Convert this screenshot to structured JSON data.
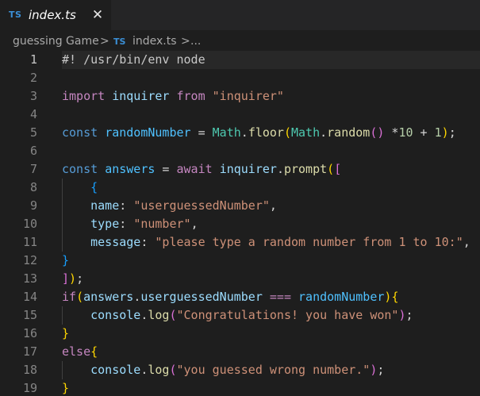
{
  "tab": {
    "icon_text": "TS",
    "filename": "index.ts",
    "close_glyph": "✕"
  },
  "breadcrumb": {
    "folder": "guessing Game",
    "sep1": ">",
    "ts_icon": "TS",
    "file": "index.ts",
    "sep2": ">",
    "more": "..."
  },
  "colors": {
    "background": "#1e1e1e",
    "keyword": "#c586c0",
    "storage": "#569cd6",
    "variable": "#9cdcfe",
    "constant": "#4fc1ff",
    "function": "#dcdcaa",
    "string": "#ce9178",
    "number": "#b5cea8",
    "ts_icon": "#3b8fd6"
  },
  "editor": {
    "current_line": 1,
    "lines": [
      {
        "n": "1",
        "tokens": [
          {
            "c": "cmt",
            "t": "#! /usr/bin/env node"
          }
        ]
      },
      {
        "n": "2",
        "tokens": []
      },
      {
        "n": "3",
        "tokens": [
          {
            "c": "kw",
            "t": "import"
          },
          {
            "c": "txt",
            "t": " "
          },
          {
            "c": "var",
            "t": "inquirer"
          },
          {
            "c": "txt",
            "t": " "
          },
          {
            "c": "kw",
            "t": "from"
          },
          {
            "c": "txt",
            "t": " "
          },
          {
            "c": "str",
            "t": "\"inquirer\""
          }
        ]
      },
      {
        "n": "4",
        "tokens": []
      },
      {
        "n": "5",
        "tokens": [
          {
            "c": "kw2",
            "t": "const"
          },
          {
            "c": "txt",
            "t": " "
          },
          {
            "c": "cst",
            "t": "randomNumber"
          },
          {
            "c": "txt",
            "t": " = "
          },
          {
            "c": "obj",
            "t": "Math"
          },
          {
            "c": "txt",
            "t": "."
          },
          {
            "c": "fn",
            "t": "floor"
          },
          {
            "c": "br1",
            "t": "("
          },
          {
            "c": "obj",
            "t": "Math"
          },
          {
            "c": "txt",
            "t": "."
          },
          {
            "c": "fn",
            "t": "random"
          },
          {
            "c": "br2",
            "t": "()"
          },
          {
            "c": "txt",
            "t": " *"
          },
          {
            "c": "num",
            "t": "10"
          },
          {
            "c": "txt",
            "t": " + "
          },
          {
            "c": "num",
            "t": "1"
          },
          {
            "c": "br1",
            "t": ")"
          },
          {
            "c": "txt",
            "t": ";"
          }
        ]
      },
      {
        "n": "6",
        "tokens": []
      },
      {
        "n": "7",
        "tokens": [
          {
            "c": "kw2",
            "t": "const"
          },
          {
            "c": "txt",
            "t": " "
          },
          {
            "c": "cst",
            "t": "answers"
          },
          {
            "c": "txt",
            "t": " = "
          },
          {
            "c": "kw",
            "t": "await"
          },
          {
            "c": "txt",
            "t": " "
          },
          {
            "c": "var",
            "t": "inquirer"
          },
          {
            "c": "txt",
            "t": "."
          },
          {
            "c": "fn",
            "t": "prompt"
          },
          {
            "c": "br1",
            "t": "("
          },
          {
            "c": "br2",
            "t": "["
          }
        ]
      },
      {
        "n": "8",
        "tokens": [
          {
            "c": "txt",
            "t": "    "
          },
          {
            "c": "br3",
            "t": "{"
          }
        ],
        "guides": [
          1
        ]
      },
      {
        "n": "9",
        "tokens": [
          {
            "c": "txt",
            "t": "    "
          },
          {
            "c": "var",
            "t": "name"
          },
          {
            "c": "txt",
            "t": ": "
          },
          {
            "c": "str",
            "t": "\"userguessedNumber\""
          },
          {
            "c": "txt",
            "t": ","
          }
        ],
        "guides": [
          1
        ]
      },
      {
        "n": "10",
        "tokens": [
          {
            "c": "txt",
            "t": "    "
          },
          {
            "c": "var",
            "t": "type"
          },
          {
            "c": "txt",
            "t": ": "
          },
          {
            "c": "str",
            "t": "\"number\""
          },
          {
            "c": "txt",
            "t": ","
          }
        ],
        "guides": [
          1
        ]
      },
      {
        "n": "11",
        "tokens": [
          {
            "c": "txt",
            "t": "    "
          },
          {
            "c": "var",
            "t": "message"
          },
          {
            "c": "txt",
            "t": ": "
          },
          {
            "c": "str",
            "t": "\"please type a random number from 1 to 10:\""
          },
          {
            "c": "txt",
            "t": ","
          }
        ],
        "guides": [
          1
        ]
      },
      {
        "n": "12",
        "tokens": [
          {
            "c": "br3",
            "t": "}"
          }
        ]
      },
      {
        "n": "13",
        "tokens": [
          {
            "c": "br2",
            "t": "]"
          },
          {
            "c": "br1",
            "t": ")"
          },
          {
            "c": "txt",
            "t": ";"
          }
        ]
      },
      {
        "n": "14",
        "tokens": [
          {
            "c": "kw",
            "t": "if"
          },
          {
            "c": "br1",
            "t": "("
          },
          {
            "c": "var",
            "t": "answers"
          },
          {
            "c": "txt",
            "t": "."
          },
          {
            "c": "var",
            "t": "userguessedNumber"
          },
          {
            "c": "txt",
            "t": " "
          },
          {
            "c": "kw",
            "t": "==="
          },
          {
            "c": "txt",
            "t": " "
          },
          {
            "c": "cst",
            "t": "randomNumber"
          },
          {
            "c": "br1",
            "t": ")"
          },
          {
            "c": "br1",
            "t": "{"
          }
        ]
      },
      {
        "n": "15",
        "tokens": [
          {
            "c": "txt",
            "t": "    "
          },
          {
            "c": "var",
            "t": "console"
          },
          {
            "c": "txt",
            "t": "."
          },
          {
            "c": "fn",
            "t": "log"
          },
          {
            "c": "br2",
            "t": "("
          },
          {
            "c": "str",
            "t": "\"Congratulations! you have won\""
          },
          {
            "c": "br2",
            "t": ")"
          },
          {
            "c": "txt",
            "t": ";"
          }
        ],
        "guides": [
          1
        ]
      },
      {
        "n": "16",
        "tokens": [
          {
            "c": "br1",
            "t": "}"
          }
        ]
      },
      {
        "n": "17",
        "tokens": [
          {
            "c": "kw",
            "t": "else"
          },
          {
            "c": "br1",
            "t": "{"
          }
        ]
      },
      {
        "n": "18",
        "tokens": [
          {
            "c": "txt",
            "t": "    "
          },
          {
            "c": "var",
            "t": "console"
          },
          {
            "c": "txt",
            "t": "."
          },
          {
            "c": "fn",
            "t": "log"
          },
          {
            "c": "br2",
            "t": "("
          },
          {
            "c": "str",
            "t": "\"you guessed wrong number.\""
          },
          {
            "c": "br2",
            "t": ")"
          },
          {
            "c": "txt",
            "t": ";"
          }
        ],
        "guides": [
          1
        ]
      },
      {
        "n": "19",
        "tokens": [
          {
            "c": "br1",
            "t": "}"
          }
        ]
      }
    ]
  }
}
